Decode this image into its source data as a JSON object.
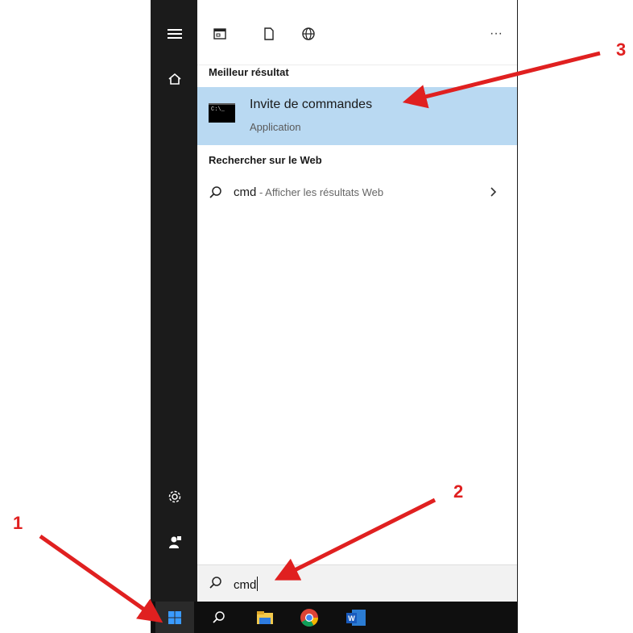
{
  "best_match": {
    "section_title": "Meilleur résultat",
    "title": "Invite de commandes",
    "subtitle": "Application",
    "icon_text": "C:\\_"
  },
  "web": {
    "section_title": "Rechercher sur le Web",
    "query": "cmd",
    "suffix": " - Afficher les résultats Web"
  },
  "search": {
    "value": "cmd"
  },
  "topbar": {
    "more_label": "···"
  },
  "annotations": {
    "one": "1",
    "two": "2",
    "three": "3"
  },
  "colors": {
    "accent_highlight": "#b9d9f2",
    "arrow": "#e02020",
    "rail": "#1b1b1b"
  },
  "icons": [
    "hamburger-icon",
    "home-icon",
    "apps-icon",
    "document-icon",
    "globe-icon",
    "settings-icon",
    "user-icon",
    "windows-icon",
    "search-icon",
    "file-explorer-icon",
    "chrome-icon",
    "word-icon"
  ]
}
